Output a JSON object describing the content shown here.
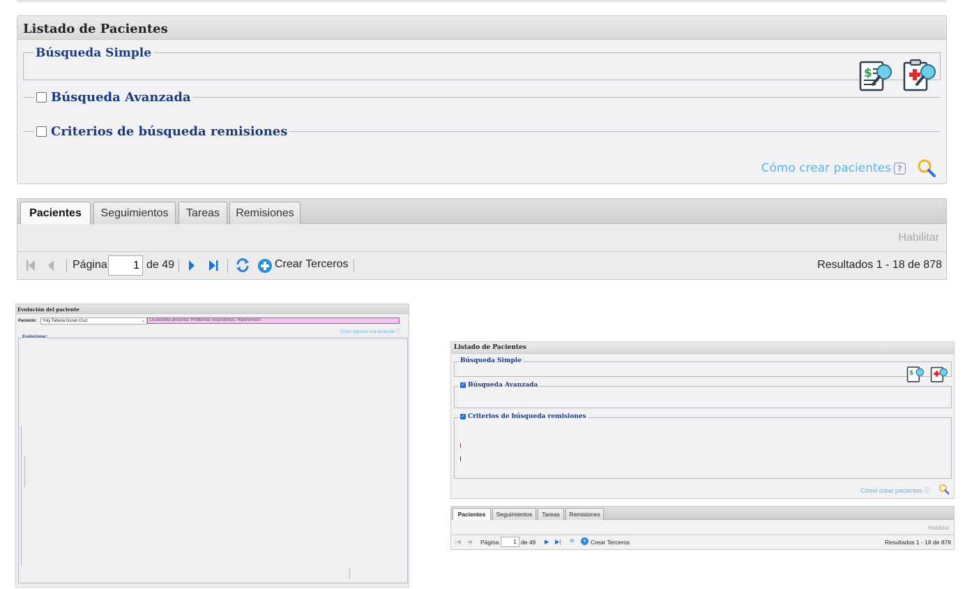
{
  "panel": {
    "title": "Listado de Pacientes",
    "simple_search_legend": "Búsqueda Simple",
    "advanced_search_label": "Búsqueda Avanzada",
    "remissions_criteria_label": "Criterios de búsqueda remisiones",
    "help_link": "Cómo crear pacientes",
    "help_icon": "question-icon",
    "search_icon": "magnifier-icon",
    "icons": [
      "billing-search-icon",
      "clinical-search-icon"
    ]
  },
  "tabs": [
    "Pacientes",
    "Seguimientos",
    "Tareas",
    "Remisiones"
  ],
  "active_tab": "Pacientes",
  "toolbar": {
    "habilitar": "Habilitar"
  },
  "pager": {
    "page_label": "Página",
    "page_value": "1",
    "of_label": "de 49",
    "create_label": "Crear Terceros",
    "results": "Resultados 1 - 18 de 878"
  },
  "evolution_thumb": {
    "title": "Evolución del paciente",
    "patient_label": "Paciente:",
    "patient_value": "Yuly Tatiana Duran Cruz",
    "alert_text": "La paciente presenta: Problemas respiratorios, Hipertensión",
    "help_link": "Cómo registrar una evolución",
    "evolve_legend": "Evolucionar:"
  },
  "colors": {
    "legend_blue": "#1c3c7c",
    "link_blue": "#55b8e6",
    "pager_blue": "#1e6fd0",
    "alert_pink": "#f4c6f2"
  }
}
